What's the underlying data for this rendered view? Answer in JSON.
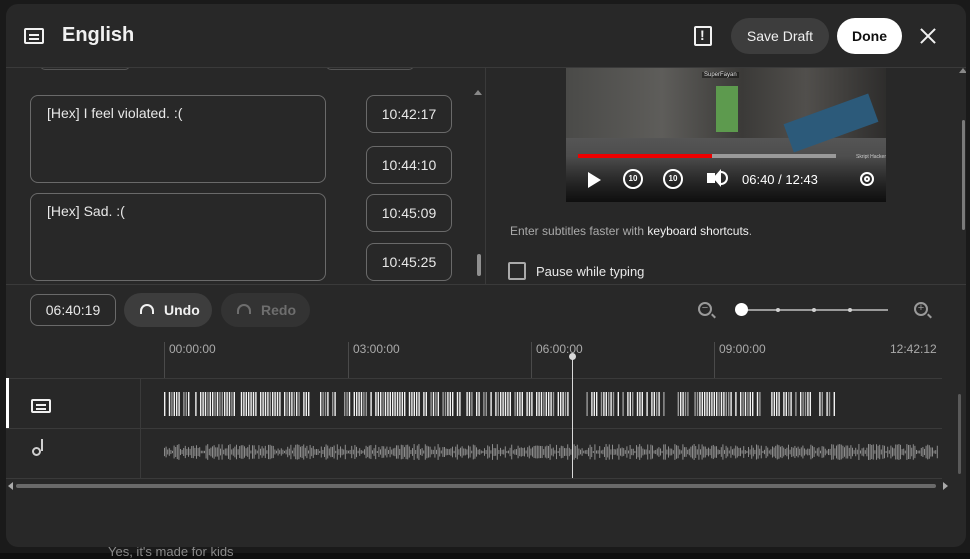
{
  "header": {
    "title": "English",
    "save_draft_label": "Save Draft",
    "done_label": "Done"
  },
  "editor": {
    "cues": [
      {
        "text": "[Hex] I feel violated. :(",
        "start": "10:42:17",
        "end": "10:44:10"
      },
      {
        "text": "[Hex] Sad. :(",
        "start": "10:45:09",
        "end": "10:45:25"
      }
    ]
  },
  "preview": {
    "player_name": "SuperFayan",
    "corner_text": "Skript Hacker",
    "time_display": "06:40 / 12:43",
    "progress_fraction": 0.52,
    "seek_back": "10",
    "seek_forward": "10",
    "hint_prefix": "Enter subtitles faster with ",
    "hint_link": "keyboard shortcuts",
    "hint_suffix": ".",
    "pause_label": "Pause while typing",
    "pause_checked": false
  },
  "toolbar": {
    "current_time": "06:40:19",
    "undo_label": "Undo",
    "redo_label": "Redo",
    "zoom_level_fraction": 0.0
  },
  "timeline": {
    "ruler": [
      "00:00:00",
      "03:00:00",
      "06:00:00",
      "09:00:00",
      "12:42:12"
    ]
  },
  "background": {
    "partial_text": "Yes, it's made for kids"
  },
  "colors": {
    "accent_red": "#ff0000",
    "panel": "#282828",
    "done_button": "#ffffff"
  }
}
